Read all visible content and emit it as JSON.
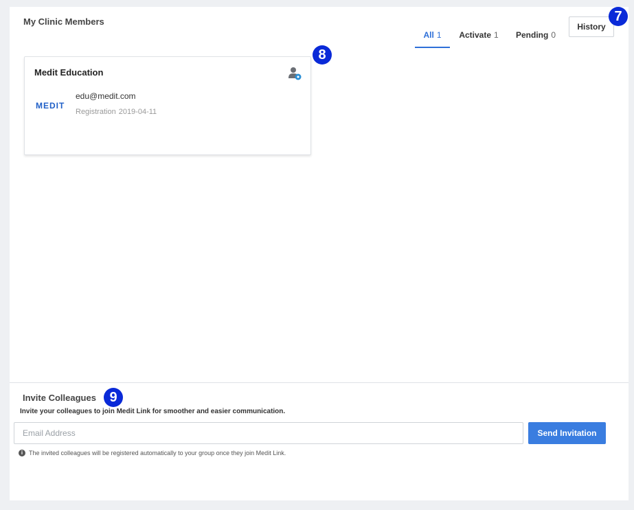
{
  "members_section": {
    "title": "My Clinic Members",
    "tabs": [
      {
        "label": "All",
        "count": "1",
        "active": true
      },
      {
        "label": "Activate",
        "count": "1",
        "active": false
      },
      {
        "label": "Pending",
        "count": "0",
        "active": false
      }
    ],
    "history_label": "History"
  },
  "badges": {
    "history": "7",
    "member_card": "8",
    "invite": "9"
  },
  "member": {
    "name": "Medit Education",
    "logo_text": "MEDIT",
    "email": "edu@medit.com",
    "registration_label": "Registration",
    "registration_date": "2019-04-11",
    "icon": "user-settings-icon"
  },
  "invite_section": {
    "title": "Invite Colleagues",
    "description": "Invite your colleagues to join Medit Link for smoother and easier communication.",
    "email_placeholder": "Email Address",
    "email_value": "",
    "send_label": "Send Invitation",
    "note": "The invited colleagues will be registered automatically to your group once they join Medit Link.",
    "note_icon": "info-icon"
  },
  "colors": {
    "accent": "#2d6fd8",
    "button": "#3a7de0",
    "badge": "#0a2ad8",
    "logo": "#1f5fc7"
  }
}
